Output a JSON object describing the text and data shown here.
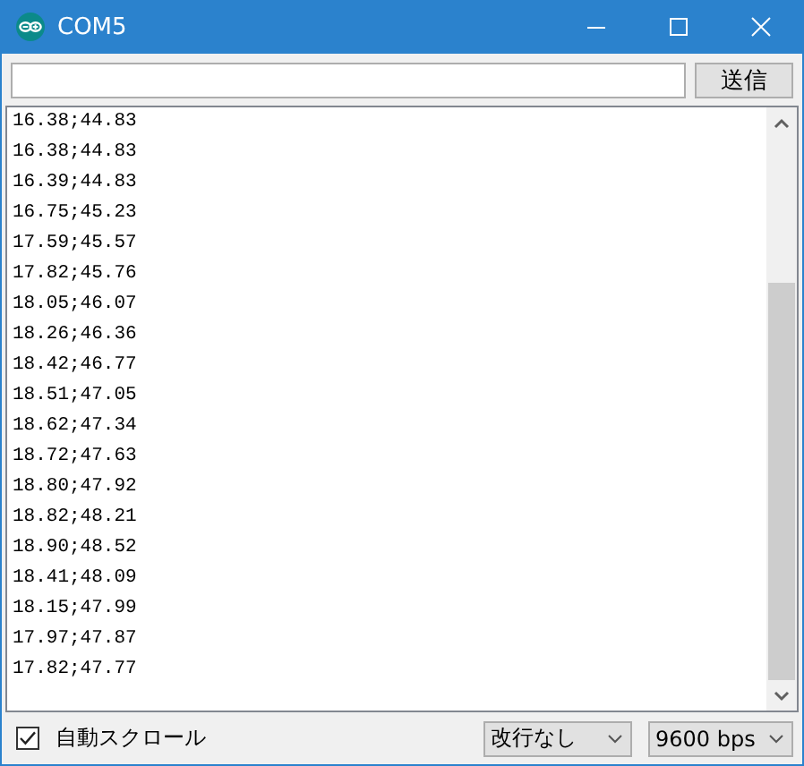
{
  "window": {
    "title": "COM5"
  },
  "send_button": {
    "label": "送信"
  },
  "output_lines": [
    "16.38;44.83",
    "16.38;44.83",
    "16.39;44.83",
    "16.75;45.23",
    "17.59;45.57",
    "17.82;45.76",
    "18.05;46.07",
    "18.26;46.36",
    "18.42;46.77",
    "18.51;47.05",
    "18.62;47.34",
    "18.72;47.63",
    "18.80;47.92",
    "18.82;48.21",
    "18.90;48.52",
    "18.41;48.09",
    "18.15;47.99",
    "17.97;47.87",
    "17.82;47.77"
  ],
  "autoscroll": {
    "label": "自動スクロール",
    "checked": true
  },
  "line_ending": {
    "value": "改行なし"
  },
  "baud_rate": {
    "value": "9600 bps"
  }
}
